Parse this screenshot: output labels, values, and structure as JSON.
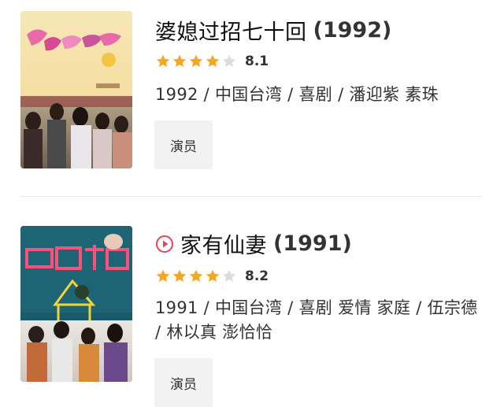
{
  "colors": {
    "star_filled": "#f5a623",
    "star_empty": "#dcdcdc",
    "play_icon": "#e0455c",
    "tag_bg": "#f2f2f2"
  },
  "items": [
    {
      "title": "婆媳过招七十回",
      "year": "(1992)",
      "has_play_icon": false,
      "stars_filled": 4,
      "stars_total": 5,
      "score": "8.1",
      "meta": "1992 / 中国台湾 / 喜剧 / 潘迎紫 素珠",
      "tag": "演员",
      "poster_icon": "drama-poster-image"
    },
    {
      "title": "家有仙妻",
      "year": "(1991)",
      "has_play_icon": true,
      "play_icon": "play-circle-icon",
      "stars_filled": 4,
      "stars_total": 5,
      "score": "8.2",
      "meta": "1991 / 中国台湾 / 喜剧 爱情 家庭 / 伍宗德 / 林以真 澎恰恰",
      "tag": "演员",
      "poster_icon": "drama-poster-image"
    }
  ]
}
